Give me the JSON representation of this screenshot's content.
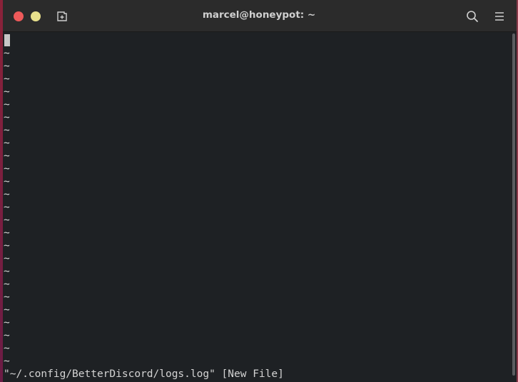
{
  "window": {
    "title": "marcel@honeypot: ~"
  },
  "titlebar": {
    "icons": [
      "close-icon",
      "minimize-icon",
      "new-tab-icon",
      "search-icon",
      "hamburger-menu-icon"
    ]
  },
  "terminal": {
    "empty_line_marker": "~",
    "empty_line_count": 25,
    "status_line": "\"~/.config/BetterDiscord/logs.log\" [New File]"
  },
  "colors": {
    "terminal_background": "#1e2124",
    "titlebar_background": "#2b2b2b",
    "close_button": "#ee5a5a",
    "minimize_button": "#e8e08c",
    "text": "#d3d3d3"
  }
}
